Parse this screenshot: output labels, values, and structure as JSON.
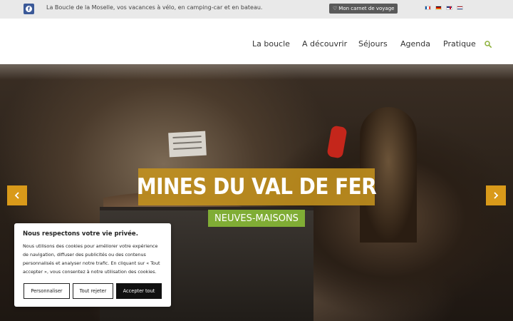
{
  "topbar": {
    "tagline": "La Boucle de la Moselle, vos vacances à vélo, en camping-car et en bateau.",
    "carnet_label": "Mon carnet de voyage",
    "facebook_icon": "facebook-icon",
    "flags": [
      "fr",
      "de",
      "en",
      "nl"
    ]
  },
  "nav": {
    "items": [
      "La boucle",
      "A découvrir",
      "Séjours",
      "Agenda",
      "Pratique"
    ],
    "search_icon": "search-icon",
    "accent_color": "#8cb03a"
  },
  "hero": {
    "title": "MINES DU VAL DE FER",
    "subtitle": "NEUVES-MAISONS",
    "title_bg": "#c4921e",
    "subtitle_bg": "#80ad35",
    "prev_icon": "chevron-left-icon",
    "next_icon": "chevron-right-icon"
  },
  "cookie": {
    "title": "Nous respectons votre vie privée.",
    "text": "Nous utilisons des cookies pour améliorer votre expérience de navigation, diffuser des publicités ou des contenus personnalisés et analyser notre trafic. En cliquant sur « Tout accepter », vous consentez à notre utilisation des cookies.",
    "btn_customize": "Personnaliser",
    "btn_reject": "Tout rejeter",
    "btn_accept": "Accepter tout"
  }
}
